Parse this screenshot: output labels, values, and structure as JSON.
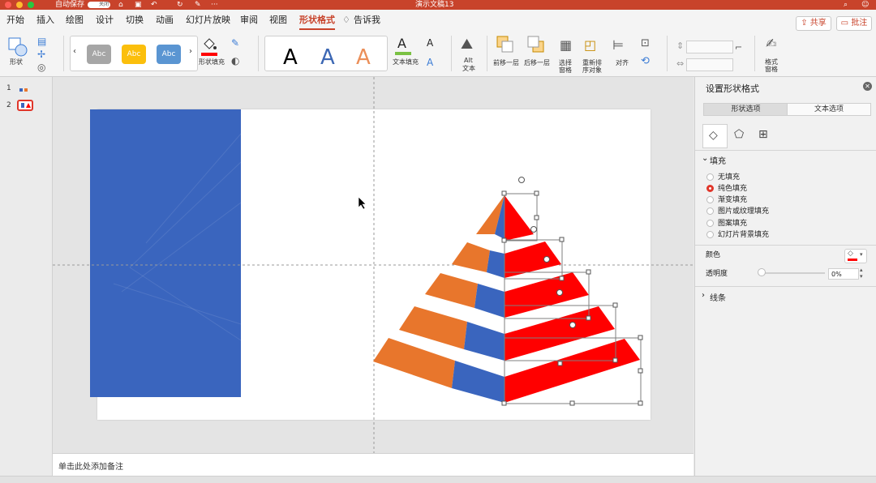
{
  "titlebar": {
    "autosave": "自动保存",
    "toggle": "关闭",
    "doc_title": "演示文稿13"
  },
  "tabs": [
    "开始",
    "插入",
    "绘图",
    "设计",
    "切换",
    "动画",
    "幻灯片放映",
    "审阅",
    "视图",
    "形状格式",
    "告诉我"
  ],
  "top_buttons": {
    "share": "共享",
    "comment": "批注"
  },
  "ribbon": {
    "shape": "形状",
    "style_swatches": [
      {
        "label": "Abc",
        "color": "#a6a6a6"
      },
      {
        "label": "Abc",
        "color": "#fbbf0c"
      },
      {
        "label": "Abc",
        "color": "#5a95d2"
      }
    ],
    "shape_fill": "形状填充",
    "wordart": [
      {
        "glyph": "A",
        "color": "#000000"
      },
      {
        "glyph": "A",
        "color": "#3c67b4"
      },
      {
        "glyph": "A",
        "color": "#eb8f59"
      }
    ],
    "text_fill": "文本填充",
    "alt_text": [
      "Alt",
      "文本"
    ],
    "bring_forward": "前移一层",
    "send_backward": "后移一层",
    "selection_pane": [
      "选择",
      "窗格"
    ],
    "reorder": [
      "重新排",
      "序对象"
    ],
    "align": "对齐",
    "format_pane": [
      "格式",
      "窗格"
    ]
  },
  "slides": [
    {
      "num": "1"
    },
    {
      "num": "2"
    }
  ],
  "notes_placeholder": "单击此处添加备注",
  "pane": {
    "title": "设置形状格式",
    "tab_shape": "形状选项",
    "tab_text": "文本选项",
    "fill_section": "填充",
    "fill_options": [
      "无填充",
      "纯色填充",
      "渐变填充",
      "图片或纹理填充",
      "图案填充",
      "幻灯片背景填充"
    ],
    "fill_selected": 1,
    "color_label": "颜色",
    "transparency_label": "透明度",
    "transparency_value": "0%",
    "line_section": "线条"
  },
  "colors": {
    "accent": "#c8432b",
    "blue": "#3a65be",
    "orange": "#e8762c",
    "red": "#ff0000",
    "selected_radio": "#e0362a"
  }
}
